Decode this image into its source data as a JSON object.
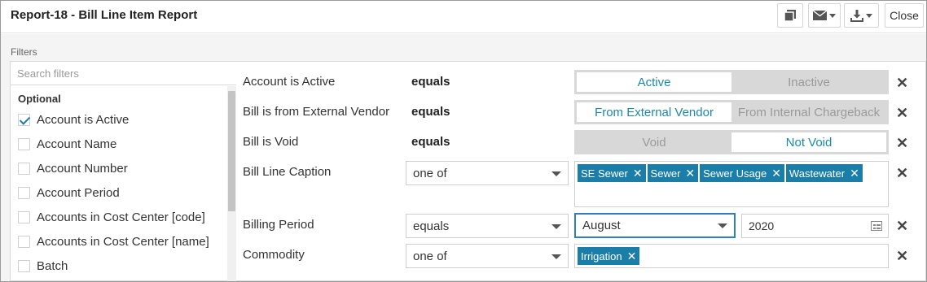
{
  "header": {
    "title": "Report-18 - Bill Line Item Report",
    "close_label": "Close",
    "buttons": [
      "copy-icon",
      "mail-icon",
      "download-icon"
    ]
  },
  "filters_label": "Filters",
  "search": {
    "placeholder": "Search filters"
  },
  "optional_heading": "Optional",
  "optional_items": [
    {
      "label": "Account is Active",
      "checked": true
    },
    {
      "label": "Account Name",
      "checked": false
    },
    {
      "label": "Account Number",
      "checked": false
    },
    {
      "label": "Account Period",
      "checked": false
    },
    {
      "label": "Accounts in Cost Center [code]",
      "checked": false
    },
    {
      "label": "Accounts in Cost Center [name]",
      "checked": false
    },
    {
      "label": "Batch",
      "checked": false
    }
  ],
  "rows": {
    "active": {
      "label": "Account is Active",
      "op": "equals",
      "opt_a": "Active",
      "opt_b": "Inactive",
      "selected": "Active"
    },
    "vendor": {
      "label": "Bill is from External Vendor",
      "op": "equals",
      "opt_a": "From External Vendor",
      "opt_b": "From Internal Chargeback",
      "selected": "From External Vendor"
    },
    "void": {
      "label": "Bill is Void",
      "op": "equals",
      "opt_a": "Void",
      "opt_b": "Not Void",
      "selected": "Not Void"
    },
    "caption": {
      "label": "Bill Line Caption",
      "op": "one of",
      "tags": [
        "SE Sewer",
        "Sewer",
        "Sewer Usage",
        "Wastewater"
      ]
    },
    "period": {
      "label": "Billing Period",
      "op": "equals",
      "month": "August",
      "year": "2020"
    },
    "commodity": {
      "label": "Commodity",
      "op": "one of",
      "tags": [
        "Irrigation"
      ]
    }
  },
  "remove_glyph": "✕",
  "tag_remove_glyph": "✕",
  "colors": {
    "accent": "#1a7ea8",
    "focus_border": "#2c7fc0"
  }
}
